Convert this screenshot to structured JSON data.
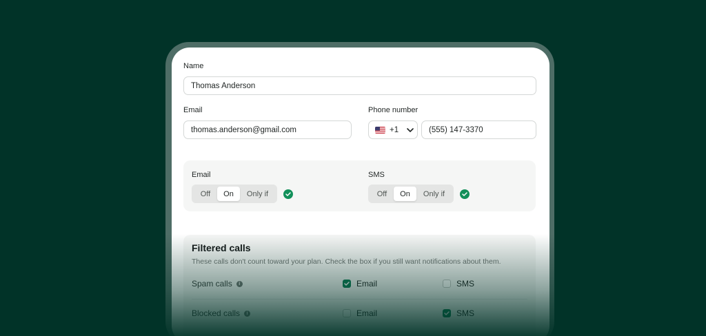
{
  "form": {
    "name_label": "Name",
    "name_value": "Thomas Anderson",
    "email_label": "Email",
    "email_value": "thomas.anderson@gmail.com",
    "phone_label": "Phone number",
    "country_code": "+1",
    "phone_value": "(555) 147-3370"
  },
  "notifications": {
    "email": {
      "label": "Email",
      "options": [
        "Off",
        "On",
        "Only if"
      ],
      "selected": "On"
    },
    "sms": {
      "label": "SMS",
      "options": [
        "Off",
        "On",
        "Only if"
      ],
      "selected": "On"
    }
  },
  "filtered": {
    "title": "Filtered calls",
    "description": "These calls don't count toward your plan. Check the box if you still want notifications about them.",
    "rows": [
      {
        "label": "Spam calls",
        "email_label": "Email",
        "email_checked": true,
        "sms_label": "SMS",
        "sms_checked": false
      },
      {
        "label": "Blocked calls",
        "email_label": "Email",
        "email_checked": false,
        "sms_label": "SMS",
        "sms_checked": true
      }
    ]
  },
  "icons": {
    "flag": "us-flag-icon",
    "chevron": "chevron-down-icon",
    "status": "check-circle-icon",
    "info": "info-icon"
  },
  "colors": {
    "background": "#013328",
    "accent": "#12905a"
  }
}
